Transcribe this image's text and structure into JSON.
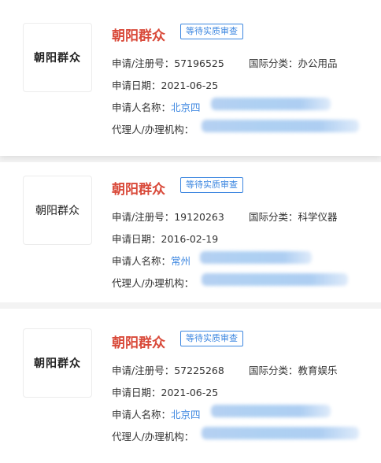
{
  "labels": {
    "reg_no": "申请/注册号：",
    "intl_class": "国际分类：",
    "date": "申请日期：",
    "applicant": "申请人名称：",
    "agent": "代理人/办理机构："
  },
  "cards": [
    {
      "logo_text": "朝阳群众",
      "title": "朝阳群众",
      "status": "等待实质审查",
      "reg_no": "57196525",
      "intl_class": "办公用品",
      "date": "2021-06-25",
      "applicant_visible": "北京四"
    },
    {
      "logo_text": "朝阳群众",
      "title": "朝阳群众",
      "status": "等待实质审查",
      "reg_no": "19120263",
      "intl_class": "科学仪器",
      "date": "2016-02-19",
      "applicant_visible": "常州"
    },
    {
      "logo_text": "朝阳群众",
      "title": "朝阳群众",
      "status": "等待实质审查",
      "reg_no": "57225268",
      "intl_class": "教育娱乐",
      "date": "2021-06-25",
      "applicant_visible": "北京四"
    }
  ],
  "colors": {
    "title": "#d94a3a",
    "badge": "#3d87e0",
    "link": "#3d87e0"
  }
}
